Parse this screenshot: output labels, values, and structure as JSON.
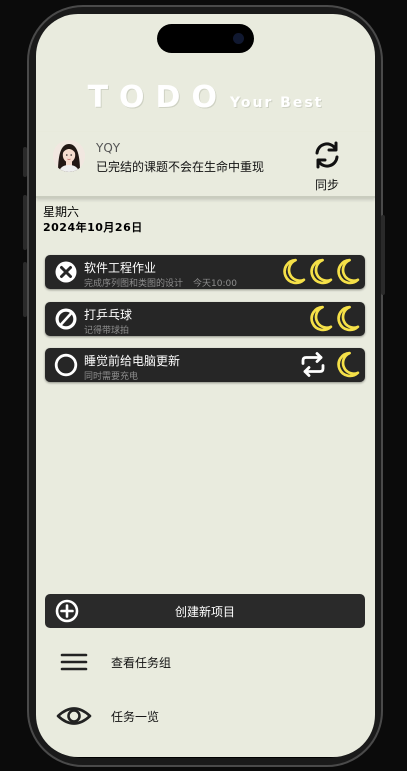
{
  "app": {
    "logo_big": "TODO",
    "logo_small": "Your Best"
  },
  "profile": {
    "username": "YQY",
    "motto": "已完结的课题不会在生命中重现",
    "sync_label": "同步",
    "avatar_icon": "user-avatar-photo"
  },
  "date": {
    "weekday": "星期六",
    "full": "2024年10月26日"
  },
  "tasks": [
    {
      "title": "软件工程作业",
      "subtitle": "完成序列图和类图的设计",
      "time": "今天10:00",
      "status_icon": "x-circle-icon",
      "moon_count": 3,
      "has_repeat": false
    },
    {
      "title": "打乒乓球",
      "subtitle": "记得带球拍",
      "time": "",
      "status_icon": "slash-circle-icon",
      "moon_count": 2,
      "has_repeat": false
    },
    {
      "title": "睡觉前给电脑更新",
      "subtitle": "同时需要充电",
      "time": "",
      "status_icon": "empty-circle-icon",
      "moon_count": 1,
      "has_repeat": true
    }
  ],
  "actions": {
    "create_label": "创建新项目",
    "groups_label": "查看任务组",
    "overview_label": "任务一览"
  },
  "colors": {
    "background": "#e9ebde",
    "card": "#262626",
    "moon": "#f5e048",
    "text_dark": "#111111"
  }
}
